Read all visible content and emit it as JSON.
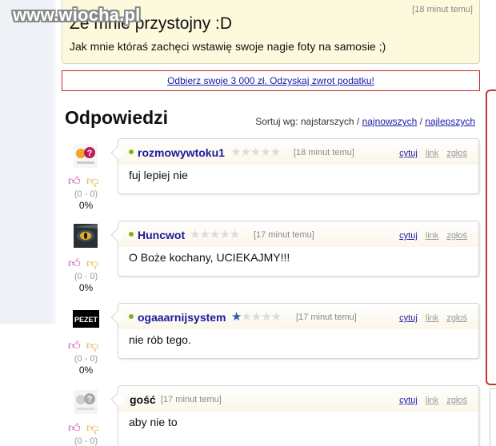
{
  "site": {
    "watermark": "www.wiocha.pl"
  },
  "post": {
    "title": "Ze mnie przystojny :D",
    "time": "[18 minut temu]",
    "text": "Jak mnie któraś zachęci wstawię swoje nagie foty na samosie ;)"
  },
  "ad": {
    "link": "Odbierz swoje 3 000 zł. Odzyskaj zwrot podatku!"
  },
  "answers": {
    "heading": "Odpowiedzi",
    "sort_prefix": "Sortuj wg: najstarszych / ",
    "sort_newest": "najnowszych",
    "sort_sep": " / ",
    "sort_best": "najlepszych"
  },
  "actions": {
    "quote": "cytuj",
    "link": "link",
    "report": "zgłoś"
  },
  "colors": {
    "accent_link": "#1a1aaa",
    "ad_border": "#c92a2a",
    "thumb_up": "#c23ea6",
    "thumb_down": "#e3a821",
    "online": "#7cb518"
  },
  "comments": [
    {
      "author": "rozmowywtoku1",
      "rating": 0,
      "time": "[18 minut temu]",
      "text": "fuj lepiej nie",
      "vote_count": "(0 - 0)",
      "vote_pct": "0%",
      "avatar": "wrzuta-question-avatar-icon"
    },
    {
      "author": "Huncwot",
      "rating": 0,
      "time": "[17 minut temu]",
      "text": "O Boże kochany, UCIEKAJMY!!!",
      "vote_count": "(0 - 0)",
      "vote_pct": "0%",
      "avatar": "wolf-eye-avatar-icon"
    },
    {
      "author": "ogaaarnijsystem",
      "rating": 0.5,
      "time": "[17 minut temu]",
      "text": "nie rób tego.",
      "vote_count": "(0 - 0)",
      "vote_pct": "0%",
      "avatar": "pezet-logo-avatar-icon"
    },
    {
      "author": "gość",
      "time": "[17 minut temu]",
      "text": "aby nie to",
      "vote_count": "(0 - 0)",
      "avatar": "grey-question-avatar-icon"
    }
  ]
}
